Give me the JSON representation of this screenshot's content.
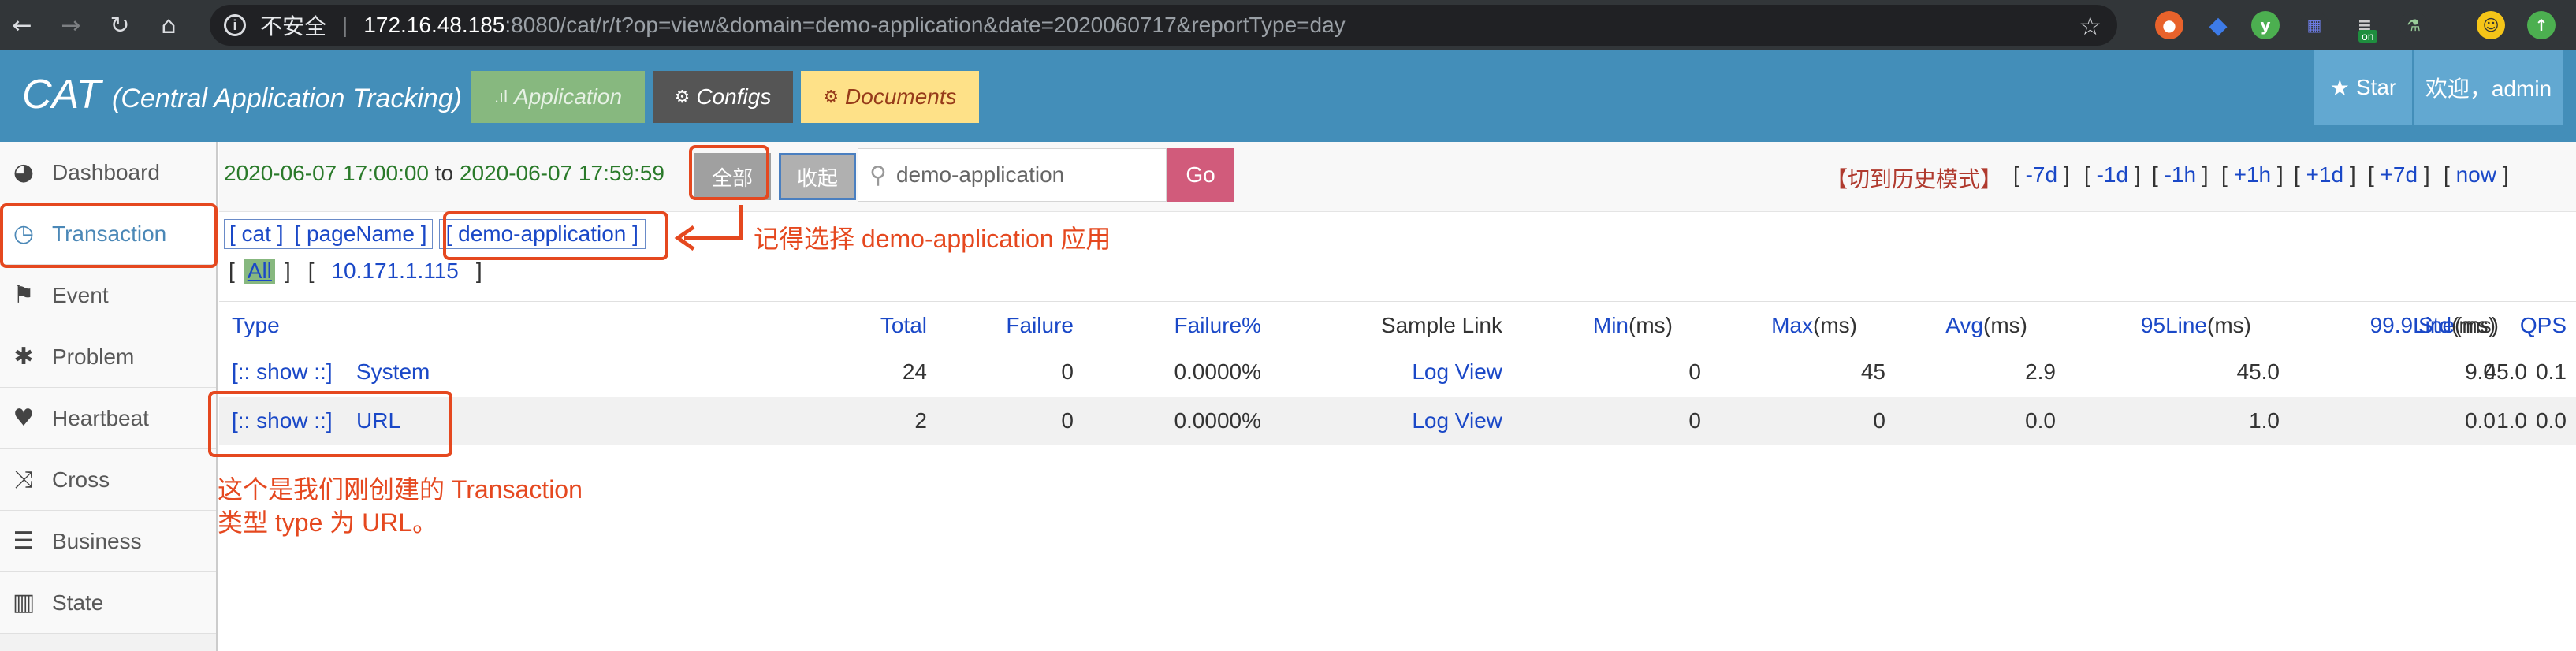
{
  "browser": {
    "security_label": "不安全",
    "url_host": "172.16.48.185",
    "url_path": ":8080/cat/r/t?op=view&domain=demo-application&date=2020060717&reportType=day",
    "ext_on_badge": "on"
  },
  "header": {
    "logo": "CAT",
    "subtitle": "(Central Application Tracking)",
    "nav": {
      "application": "Application",
      "configs": "Configs",
      "documents": "Documents"
    },
    "star_label": "Star",
    "welcome": "欢迎，admin"
  },
  "sidebar": {
    "items": [
      {
        "label": "Dashboard",
        "icon": "dashboard-icon"
      },
      {
        "label": "Transaction",
        "icon": "clock-icon"
      },
      {
        "label": "Event",
        "icon": "flag-icon"
      },
      {
        "label": "Problem",
        "icon": "bug-icon"
      },
      {
        "label": "Heartbeat",
        "icon": "heart-icon"
      },
      {
        "label": "Cross",
        "icon": "shuffle-icon"
      },
      {
        "label": "Business",
        "icon": "list-icon"
      },
      {
        "label": "State",
        "icon": "bar-chart-icon"
      }
    ],
    "active": "Transaction"
  },
  "toolbar": {
    "time_start": "2020-06-07 17:00:00",
    "time_to": "to",
    "time_end": "2020-06-07 17:59:59",
    "all_button": "全部",
    "fold_button": "收起",
    "search_value": "demo-application",
    "go_button": "Go",
    "history_mode": "【切到历史模式】",
    "quick_ranges": [
      "-7d",
      "-1d",
      "-1h",
      "+1h",
      "+1d",
      "+7d",
      "now"
    ]
  },
  "breadcrumb": {
    "items": [
      "[ cat ]",
      "[ pageName ]"
    ],
    "selected": "[ demo-application ]"
  },
  "ip_filter": {
    "all": "All",
    "ips": [
      "10.171.1.115"
    ]
  },
  "table": {
    "headers": {
      "type": "Type",
      "total": "Total",
      "failure": "Failure",
      "failure_pct": "Failure%",
      "sample_link": "Sample Link",
      "min": "Min",
      "max": "Max",
      "avg": "Avg",
      "line95": "95Line",
      "line999": "99.9Line",
      "std": "Std",
      "qps": "QPS",
      "ms_unit": "(ms)"
    },
    "rows": [
      {
        "show": "[:: show ::]",
        "type": "System",
        "total": "24",
        "failure": "0",
        "failure_pct": "0.0000%",
        "sample": "Log View",
        "min": "0",
        "max": "45",
        "avg": "2.9",
        "line95": "45.0",
        "line999": "45.0",
        "std": "9.0",
        "qps": "0.1"
      },
      {
        "show": "[:: show ::]",
        "type": "URL",
        "total": "2",
        "failure": "0",
        "failure_pct": "0.0000%",
        "sample": "Log View",
        "min": "0",
        "max": "0",
        "avg": "0.0",
        "line95": "1.0",
        "line999": "1.0",
        "std": "0.0",
        "qps": "0.0"
      }
    ]
  },
  "annotations": {
    "select_app": "记得选择 demo-application 应用",
    "url_type_line1": "这个是我们刚创建的 Transaction",
    "url_type_line2": "类型 type 为 URL。"
  },
  "colors": {
    "header_bg": "#438eb9",
    "annotation_red": "#e5481f",
    "link_blue": "#1a48c7",
    "time_green": "#2a7a2a"
  }
}
